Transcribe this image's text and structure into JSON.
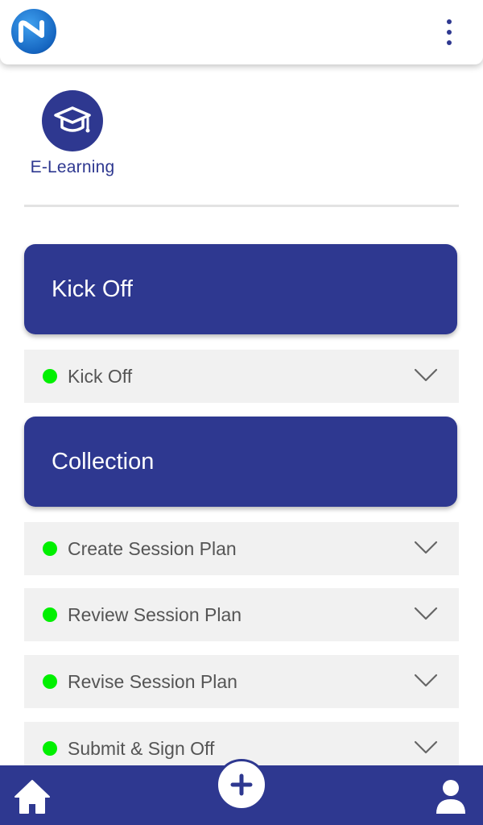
{
  "header": {
    "logo_icon": "brand-logo-icon",
    "menu_icon": "kebab-menu-icon"
  },
  "module": {
    "label": "E-Learning",
    "icon": "graduation-cap-icon"
  },
  "sections": [
    {
      "title": "Kick Off",
      "steps": [
        {
          "label": "Kick Off",
          "status_color": "#00f000"
        }
      ]
    },
    {
      "title": "Collection",
      "steps": [
        {
          "label": "Create Session Plan",
          "status_color": "#00f000"
        },
        {
          "label": "Review Session Plan",
          "status_color": "#00f000"
        },
        {
          "label": "Revise Session Plan",
          "status_color": "#00f000"
        },
        {
          "label": "Submit & Sign Off",
          "status_color": "#00f000"
        }
      ]
    }
  ],
  "bottom_nav": {
    "home_icon": "home-icon",
    "add_icon": "plus-icon",
    "profile_icon": "user-icon"
  },
  "colors": {
    "brand": "#2e3890",
    "status_complete": "#00f000",
    "row_background": "#f1f1f1"
  }
}
